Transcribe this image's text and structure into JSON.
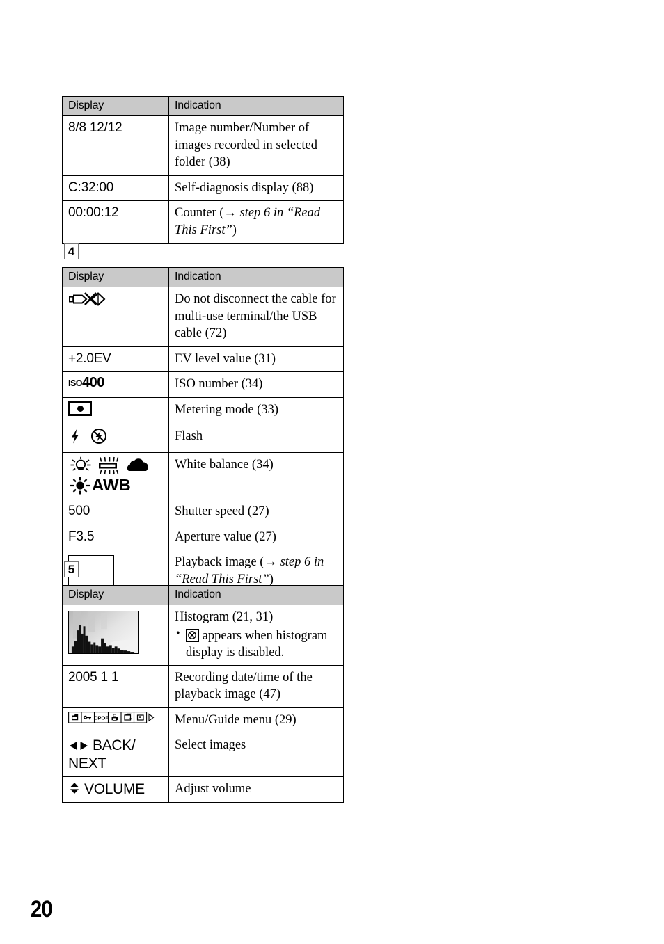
{
  "page": {
    "number": "20"
  },
  "columns": {
    "display": "Display",
    "indication": "Indication"
  },
  "section_3_table": {
    "rows": [
      {
        "display": "8/8 12/12",
        "indication": "Image number/Number of images recorded in selected folder (38)"
      },
      {
        "display": "C:32:00",
        "indication": "Self-diagnosis display (88)"
      },
      {
        "display": "00:00:12",
        "indication_pre": "Counter (",
        "indication_arrow": "→",
        "indication_italic": "step 6 in “Read This First”",
        "indication_post": ")"
      }
    ]
  },
  "marker_4": "4",
  "section_4_table": {
    "rows": [
      {
        "display_icon": "usb-do-not-disconnect-icon",
        "indication": "Do not disconnect the cable for multi-use terminal/the USB cable (72)"
      },
      {
        "display": "+2.0EV",
        "indication": "EV level value (31)"
      },
      {
        "display_iso_prefix": "ISO",
        "display_iso_value": "400",
        "indication": "ISO number (34)"
      },
      {
        "display_icon": "metering-mode-icon",
        "indication": "Metering mode (33)"
      },
      {
        "display_icon": "flash-icons",
        "indication": "Flash"
      },
      {
        "display_icon": "white-balance-icons",
        "display_awb": "AWB",
        "indication": "White balance (34)"
      },
      {
        "display": "500",
        "indication": "Shutter speed (27)"
      },
      {
        "display": "F3.5",
        "indication": "Aperture value (27)"
      },
      {
        "display_icon": "playback-image-frame-icon",
        "indication_pre": "Playback image (",
        "indication_arrow": "→",
        "indication_italic": "step 6 in “Read This First”",
        "indication_post": ")"
      }
    ]
  },
  "marker_5": "5",
  "section_5_table": {
    "rows": [
      {
        "display_icon": "histogram-thumbnail-icon",
        "indication": "Histogram (21, 31)",
        "bullet_pre": "",
        "bullet_icon": "histogram-disabled-icon",
        "bullet_post": "appears when histogram display is disabled."
      },
      {
        "display": "2005 1 1",
        "indication": "Recording date/time of the playback image (47)"
      },
      {
        "display_icon": "menu-guide-strip-icon",
        "indication": "Menu/Guide menu (29)"
      },
      {
        "display_keys": "BACK/ NEXT",
        "display_keys_line1": "BACK/",
        "display_keys_line2": "NEXT",
        "indication": "Select images"
      },
      {
        "display_keys_line1": "VOLUME",
        "indication": "Adjust volume"
      }
    ]
  },
  "colors": {
    "header_bg": "#c9c9c9",
    "rule": "#000000",
    "marker_border": "#777777",
    "text": "#000000"
  }
}
